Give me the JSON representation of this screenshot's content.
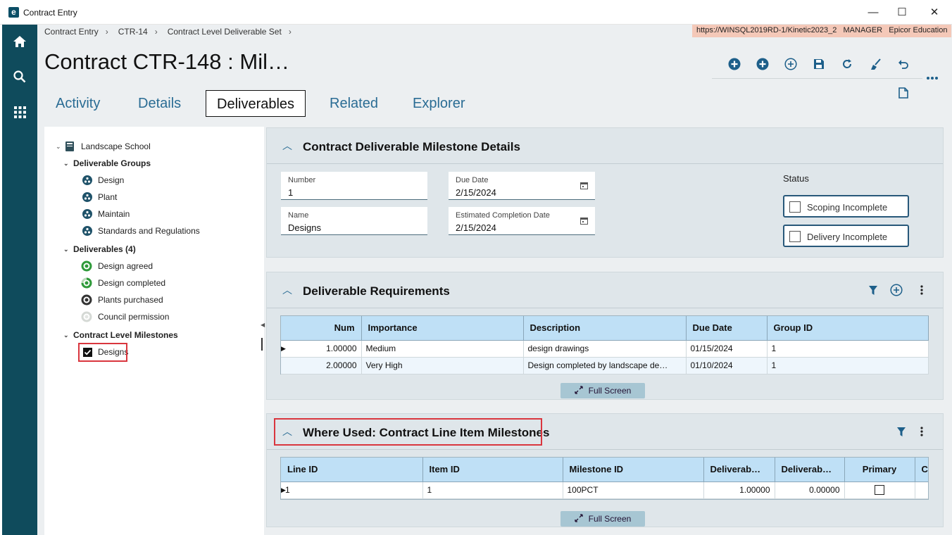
{
  "window": {
    "title": "Contract Entry",
    "logo_letter": "e",
    "minimize": "—",
    "maximize": "☐",
    "close": "✕"
  },
  "rail": {
    "icons": [
      "home-icon",
      "search-icon",
      "apps-grid-icon"
    ]
  },
  "breadcrumb": [
    "Contract Entry",
    "CTR-14",
    "Contract Level Deliverable Set"
  ],
  "breadcrumb_sep": "›",
  "server_info": "https://WINSQL2019RD-1/Kinetic2023_2   MANAGER   Epicor Education",
  "page_title": "Contract CTR-148 : Mil…",
  "toolbar": [
    "add-new-icon",
    "add-icon",
    "add-outline-icon",
    "save-icon",
    "refresh-icon",
    "clear-icon",
    "undo-icon",
    "more-icon",
    "document-icon"
  ],
  "tabs": [
    "Activity",
    "Details",
    "Deliverables",
    "Related",
    "Explorer"
  ],
  "active_tab": "Deliverables",
  "tree": {
    "root": "Landscape School",
    "groups_label": "Deliverable Groups",
    "groups": [
      "Design",
      "Plant",
      "Maintain",
      "Standards and Regulations"
    ],
    "deliverables_label": "Deliverables (4)",
    "deliverables": [
      "Design agreed",
      "Design completed",
      "Plants purchased",
      "Council permission"
    ],
    "milestones_label": "Contract Level Milestones",
    "milestones": [
      "Designs"
    ]
  },
  "details": {
    "title": "Contract Deliverable Milestone Details",
    "number_label": "Number",
    "number_value": "1",
    "due_label": "Due Date",
    "due_value": "2/15/2024",
    "name_label": "Name",
    "name_value": "Designs",
    "est_label": "Estimated Completion Date",
    "est_value": "2/15/2024",
    "status_label": "Status",
    "scoping": "Scoping Incomplete",
    "delivery": "Delivery Incomplete"
  },
  "requirements": {
    "title": "Deliverable Requirements",
    "columns": [
      "Num",
      "Importance",
      "Description",
      "Due Date",
      "Group ID"
    ],
    "rows": [
      [
        "1.00000",
        "Medium",
        "design drawings",
        "01/15/2024",
        "1"
      ],
      [
        "2.00000",
        "Very High",
        "Design completed by landscape de…",
        "01/10/2024",
        "1"
      ]
    ],
    "fullscreen": "Full Screen"
  },
  "where_used": {
    "title": "Where Used: Contract Line Item Milestones",
    "columns": [
      "Line ID",
      "Item ID",
      "Milestone ID",
      "Deliverab…",
      "Deliverab…",
      "Primary",
      "Co"
    ],
    "rows": [
      [
        "1",
        "1",
        "100PCT",
        "1.00000",
        "0.00000",
        "",
        ""
      ]
    ],
    "fullscreen": "Full Screen"
  },
  "colors": {
    "rail": "#0f4b5c",
    "accent": "#2a6c94",
    "highlight": "#d9363e"
  }
}
